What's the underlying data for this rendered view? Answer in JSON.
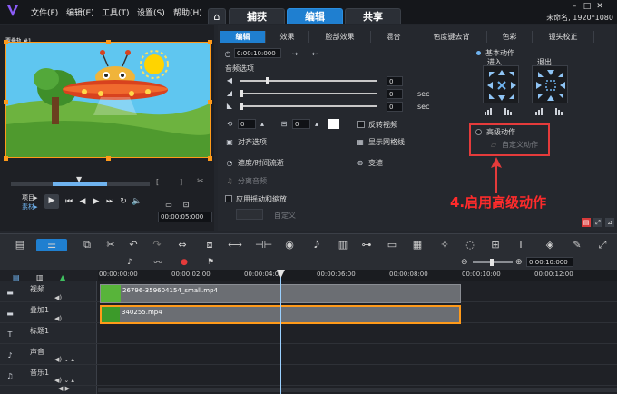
{
  "app": {
    "menu": [
      "文件(F)",
      "编辑(E)",
      "工具(T)",
      "设置(S)",
      "帮助(H)"
    ],
    "main_tabs": [
      "捕获",
      "编辑",
      "共享"
    ],
    "active_main_tab": "编辑",
    "project_info": "未命名, 1920*1080",
    "colors": {
      "accent": "#1f7fd0",
      "selection": "#ff9a1a",
      "annotation": "#e53b3b"
    }
  },
  "preview": {
    "clip_label": "覆叠轨 #1",
    "mode_labels": [
      "项目▸",
      "素材▸"
    ],
    "timecode": "00:00:05:000"
  },
  "options": {
    "sub_tabs": [
      "编辑",
      "效果",
      "脸部效果",
      "混合",
      "色度键去背",
      "色彩",
      "镜头校正"
    ],
    "active_sub_tab": "编辑",
    "duration": "0:00:10:000",
    "audio_section": "音频选项",
    "audio_unit": "sec",
    "audio_values": [
      "0",
      "0",
      "0"
    ],
    "rotate_values": [
      "0",
      "0"
    ],
    "reverse_video": "反转视频",
    "align_options": "对齐选项",
    "show_grid": "显示网格线",
    "speed_time": "速度/时间流逝",
    "variable_speed": "变速",
    "split_audio": "分离音频",
    "apply_pan_zoom": "应用摇动和缩放",
    "custom": "自定义",
    "basic_motion": "基本动作",
    "enter": "进入",
    "exit": "退出",
    "advanced_motion": "高级动作",
    "custom_motion": "自定义动作",
    "annotation": "4.启用高级动作"
  },
  "timeline": {
    "ruler_ticks": [
      "00:00:00:00",
      "00:00:02:00",
      "00:00:04:00",
      "00:00:06:00",
      "00:00:08:00",
      "00:00:10:00",
      "00:00:12:00"
    ],
    "zoom_time": "0:00:10:000",
    "tracks": [
      {
        "name": "视频",
        "clip": "26796-359604154_small.mp4"
      },
      {
        "name": "叠加1",
        "clip": "340255.mp4"
      },
      {
        "name": "标题1",
        "clip": ""
      },
      {
        "name": "声音",
        "clip": ""
      },
      {
        "name": "音乐1",
        "clip": ""
      }
    ]
  }
}
